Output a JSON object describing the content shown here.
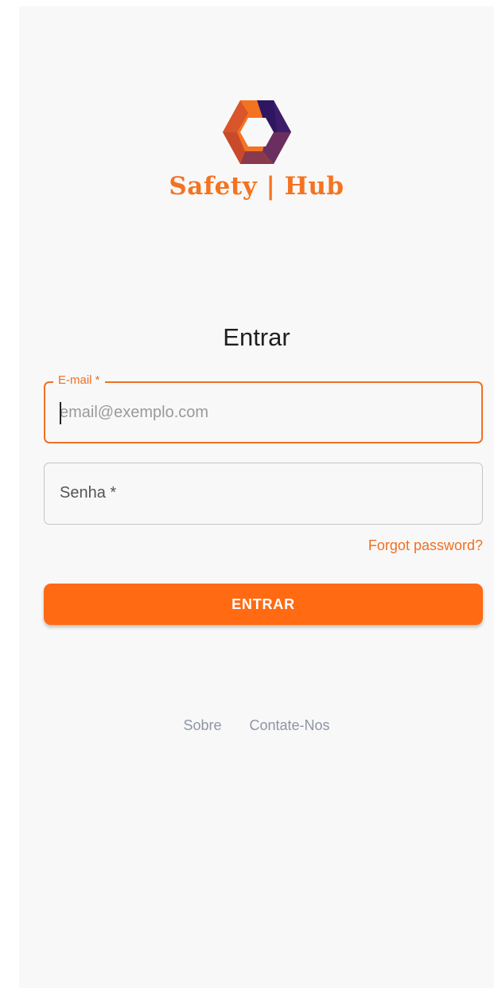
{
  "brand": {
    "name": "Safety | Hub",
    "logo_icon": "hexagon-aperture-logo-icon",
    "colors": {
      "orange": "#f47321",
      "orange_dark": "#c94a2b",
      "purple": "#2e1660",
      "purple_mid": "#6a2f5e"
    }
  },
  "login": {
    "title": "Entrar",
    "email": {
      "label": "E-mail *",
      "placeholder": "email@exemplo.com",
      "value": ""
    },
    "password": {
      "label": "Senha *",
      "value": ""
    },
    "forgot_label": "Forgot password?",
    "submit_label": "ENTRAR"
  },
  "footer": {
    "links": [
      "Sobre",
      "Contate-Nos"
    ]
  },
  "theme": {
    "accent": "#ff6a13",
    "background": "#f8f8f8",
    "link_gray": "#8e95a6"
  }
}
